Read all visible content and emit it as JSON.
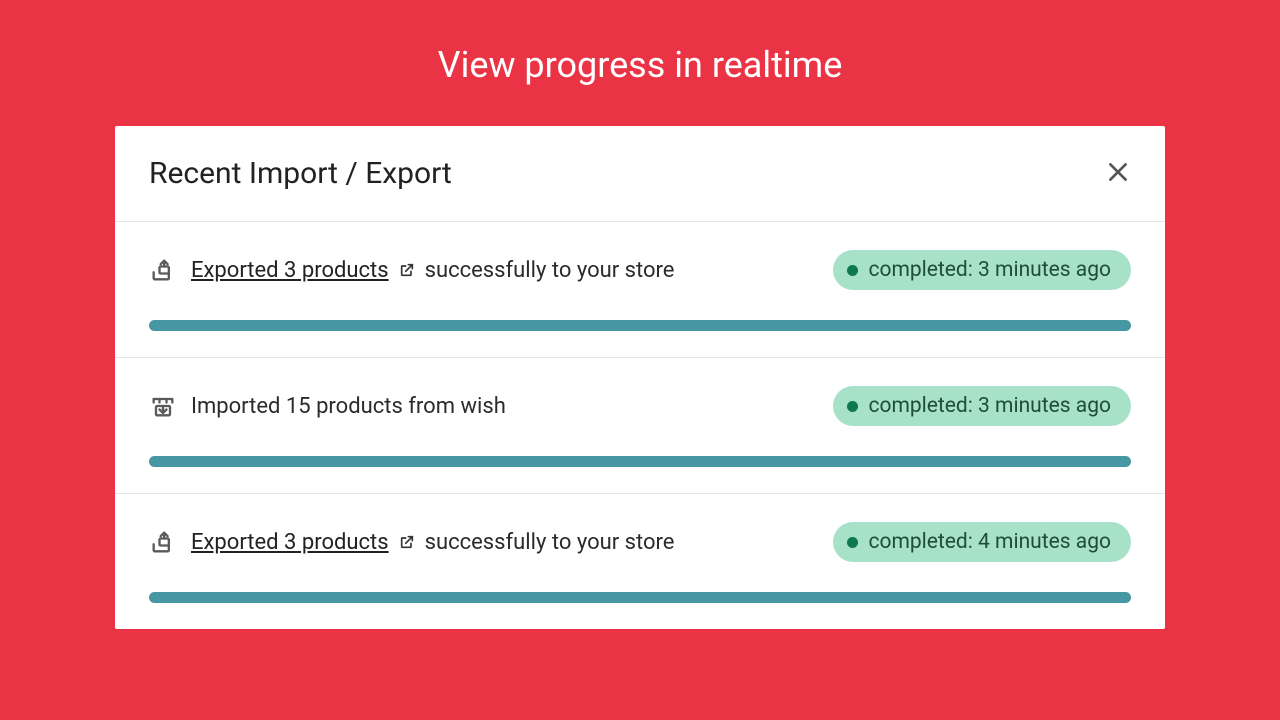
{
  "hero": {
    "title": "View progress in realtime"
  },
  "panel": {
    "title": "Recent Import / Export",
    "items": [
      {
        "kind": "export",
        "link_text": "Exported 3 products",
        "suffix_text": "successfully to your store",
        "badge_text": "completed: 3 minutes ago",
        "progress_pct": 100
      },
      {
        "kind": "import",
        "plain_text": "Imported 15 products from wish",
        "badge_text": "completed: 3 minutes ago",
        "progress_pct": 100
      },
      {
        "kind": "export",
        "link_text": "Exported 3 products",
        "suffix_text": "successfully to your store",
        "badge_text": "completed: 4 minutes ago",
        "progress_pct": 100
      }
    ]
  },
  "colors": {
    "background": "#eb3346",
    "badge_bg": "#a7e2c8",
    "badge_dot": "#0d7a4d",
    "progress": "#4797a2"
  }
}
